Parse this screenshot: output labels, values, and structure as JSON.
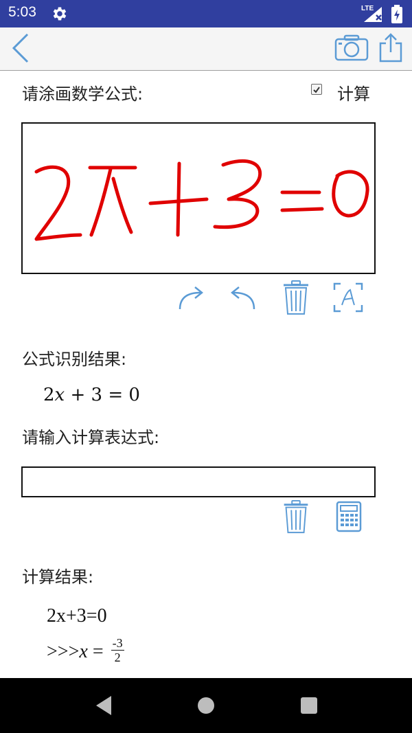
{
  "status_bar": {
    "time": "5:03",
    "network": "LTE",
    "icons": [
      "gear-icon",
      "signal-icon",
      "battery-icon"
    ]
  },
  "toolbar": {
    "icons": [
      "back-icon",
      "camera-icon",
      "share-icon"
    ]
  },
  "colors": {
    "status_bar": "#303f9f",
    "toolbar": "#f5f5f5",
    "icon_blue": "#5b9bd5",
    "ink": "#e00000",
    "nav_bar": "#000000"
  },
  "draw_section": {
    "label": "请涂画数学公式:",
    "calc_checkbox_label": "计算",
    "calc_checked": true,
    "handwriting": "2x+3=0"
  },
  "canvas_tools": [
    "redo-icon",
    "undo-icon",
    "trash-icon",
    "recognize-icon"
  ],
  "recognition": {
    "label": "公式识别结果:",
    "formula_left": "2",
    "formula_var": "x",
    "formula_right": " + 3 = 0"
  },
  "input_section": {
    "label": "请输入计算表达式:",
    "value": "",
    "tools": [
      "trash-icon",
      "calculator-icon"
    ]
  },
  "calc_result": {
    "label": "计算结果:",
    "line1": "2x+3=0",
    "line2_prefix": ">>>",
    "line2_var": "x",
    "line2_eq": " = ",
    "numerator": "-3",
    "denominator": "2"
  },
  "nav_bar": {
    "icons": [
      "nav-back-icon",
      "nav-home-icon",
      "nav-recent-icon"
    ]
  }
}
